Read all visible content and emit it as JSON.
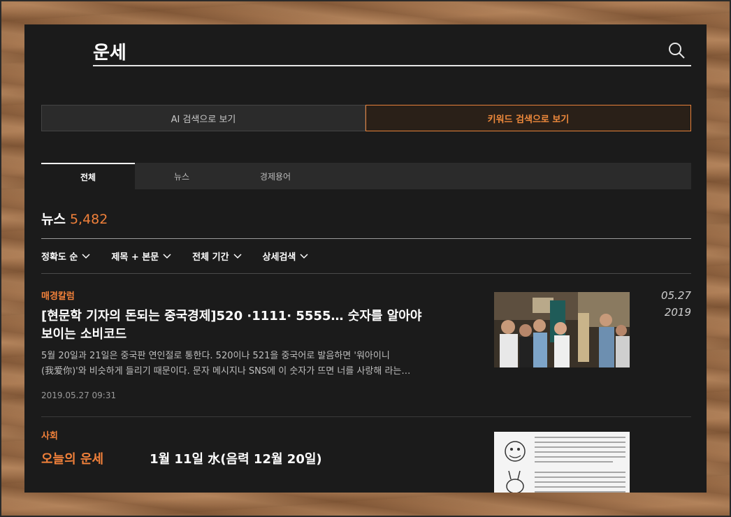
{
  "search": {
    "query": "운세"
  },
  "mode_toggle": {
    "ai_label": "AI 검색으로 보기",
    "keyword_label": "키워드 검색으로 보기"
  },
  "tabs": [
    {
      "label": "전체"
    },
    {
      "label": "뉴스"
    },
    {
      "label": "경제용어"
    }
  ],
  "results": {
    "label": "뉴스",
    "count": "5,482"
  },
  "filters": [
    {
      "label": "정확도 순"
    },
    {
      "label": "제목 + 본문"
    },
    {
      "label": "전체 기간"
    },
    {
      "label": "상세검색"
    }
  ],
  "articles": [
    {
      "category": "매경칼럼",
      "title_line1": "[현문학 기자의 돈되는 중국경제]520 ·1111· 5555… 숫자를 알아야",
      "title_line2": "보이는 소비코드",
      "summary_line1": "5월 20일과 21일은 중국판 연인절로 통한다. 520이나 521을 중국어로 발음하면 '워아이니",
      "summary_line2": "(我爱你)'와 비슷하게 들리기 때문이다. 문자 메시지나 SNS에 이 숫자가 뜨면 너를 사랑해 라는…",
      "timestamp": "2019.05.27 09:31",
      "date_md": "05.27",
      "date_year": "2019"
    },
    {
      "category": "사회",
      "title_highlight": "오늘의 운세",
      "title_rest": "1월 11일 水(음력 12월 20일)"
    }
  ],
  "colors": {
    "accent": "#f0803a",
    "panel": "#1b1b1b"
  }
}
